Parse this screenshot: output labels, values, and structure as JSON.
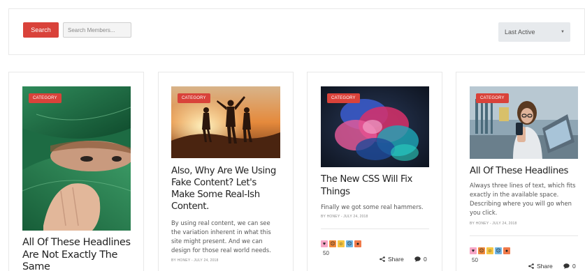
{
  "search": {
    "button_label": "Search",
    "placeholder": "Search Members...",
    "sort_value": "Last Active"
  },
  "cards": [
    {
      "badge": "CATEGORY",
      "title_lines": [
        "All Of These Headlines",
        "Are Not Exactly The",
        "Same"
      ]
    },
    {
      "badge": "CATEGORY",
      "title_lines": [
        "Also, Why Are We Using",
        "Fake Content? Let's",
        "Make Some Real-Ish",
        "Content."
      ],
      "excerpt_lines": [
        "By using real content, we can see",
        "the variation inherent in what this",
        "site might present. And we can",
        "design for those real world needs."
      ],
      "meta": "BY HONEY - JULY 24, 2018"
    },
    {
      "badge": "CATEGORY",
      "title_lines": [
        "The New CSS Will Fix",
        "Things"
      ],
      "excerpt_lines": [
        "Finally we got some real hammers."
      ],
      "meta": "BY HONEY - JULY 24, 2018",
      "reaction_count": "50",
      "share_label": "Share",
      "comment_count": "0"
    },
    {
      "badge": "CATEGORY",
      "title_lines": [
        "All Of These Headlines"
      ],
      "excerpt_lines": [
        "Always three lines of text, which fits",
        "exactly in the available space.",
        "Describing where you will go when",
        "you click."
      ],
      "meta": "BY HONEY - JULY 24, 2018",
      "reaction_count": "50",
      "share_label": "Share",
      "comment_count": "0"
    }
  ],
  "icons": {
    "share": "share-icon",
    "comment": "comment-bubble-icon",
    "caret": "chevron-down-icon"
  },
  "colors": {
    "accent": "#d9423a",
    "select_bg": "#e7eaed"
  }
}
